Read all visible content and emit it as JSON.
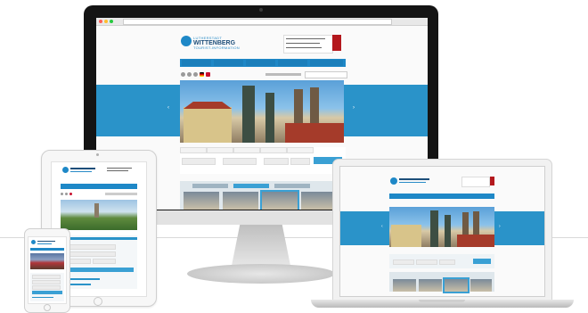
{
  "site": {
    "logo_line1": "LUTHERSTADT",
    "logo_line2": "WITTENBERG",
    "logo_line3": "TOURIST-INFORMATION"
  },
  "colors": {
    "brand_blue": "#1e88c7",
    "hero_band": "#2a93c9",
    "logo_navy": "#1d4e7a",
    "badge_red": "#b4181d"
  },
  "icons": {
    "logo": "globe-mark",
    "hero_prev": "chevron-left-icon",
    "hero_next": "chevron-right-icon",
    "phone_icon": "phone-icon",
    "mail_icon": "mail-icon"
  },
  "devices": [
    "desktop-monitor",
    "laptop",
    "tablet",
    "phone"
  ],
  "arrows": {
    "prev": "‹",
    "next": "›"
  }
}
